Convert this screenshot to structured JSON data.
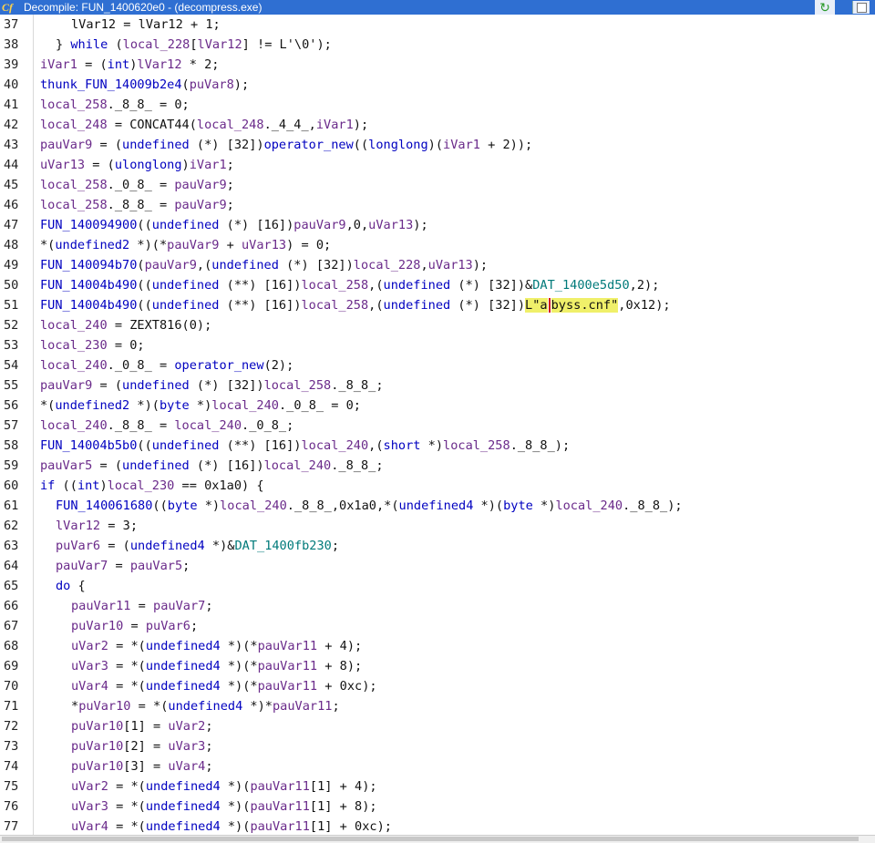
{
  "window": {
    "title": "Decompile: FUN_1400620e0 - (decompress.exe)",
    "app_icon": "Cf",
    "refresh_icon": "refresh-icon",
    "snapshot_icon": "snapshot-icon"
  },
  "lines": [
    {
      "n": "37",
      "indent": 2,
      "tokens": [
        {
          "t": "lVar12 = lVar12 + 1;"
        }
      ]
    },
    {
      "n": "38",
      "indent": 1,
      "tokens": [
        {
          "t": "} "
        },
        {
          "t": "while",
          "c": "kw"
        },
        {
          "t": " ("
        },
        {
          "t": "local_228",
          "c": "var"
        },
        {
          "t": "["
        },
        {
          "t": "lVar12",
          "c": "var"
        },
        {
          "t": "] != L'\\0');"
        }
      ]
    },
    {
      "n": "39",
      "indent": 0,
      "tokens": [
        {
          "t": "iVar1",
          "c": "var"
        },
        {
          "t": " = ("
        },
        {
          "t": "int",
          "c": "ty"
        },
        {
          "t": ")"
        },
        {
          "t": "lVar12",
          "c": "var"
        },
        {
          "t": " * 2;"
        }
      ]
    },
    {
      "n": "40",
      "indent": 0,
      "tokens": [
        {
          "t": "thunk_FUN_14009b2e4",
          "c": "fn"
        },
        {
          "t": "("
        },
        {
          "t": "puVar8",
          "c": "var"
        },
        {
          "t": ");"
        }
      ]
    },
    {
      "n": "41",
      "indent": 0,
      "tokens": [
        {
          "t": "local_258",
          "c": "var"
        },
        {
          "t": "._8_8_ = 0;"
        }
      ]
    },
    {
      "n": "42",
      "indent": 0,
      "tokens": [
        {
          "t": "local_248",
          "c": "var"
        },
        {
          "t": " = CONCAT44("
        },
        {
          "t": "local_248",
          "c": "var"
        },
        {
          "t": "._4_4_,"
        },
        {
          "t": "iVar1",
          "c": "var"
        },
        {
          "t": ");"
        }
      ]
    },
    {
      "n": "43",
      "indent": 0,
      "tokens": [
        {
          "t": "pauVar9",
          "c": "var"
        },
        {
          "t": " = ("
        },
        {
          "t": "undefined",
          "c": "ty"
        },
        {
          "t": " (*) [32])"
        },
        {
          "t": "operator_new",
          "c": "fn"
        },
        {
          "t": "(("
        },
        {
          "t": "longlong",
          "c": "ty"
        },
        {
          "t": ")("
        },
        {
          "t": "iVar1",
          "c": "var"
        },
        {
          "t": " + 2));"
        }
      ]
    },
    {
      "n": "44",
      "indent": 0,
      "tokens": [
        {
          "t": "uVar13",
          "c": "var"
        },
        {
          "t": " = ("
        },
        {
          "t": "ulonglong",
          "c": "ty"
        },
        {
          "t": ")"
        },
        {
          "t": "iVar1",
          "c": "var"
        },
        {
          "t": ";"
        }
      ]
    },
    {
      "n": "45",
      "indent": 0,
      "tokens": [
        {
          "t": "local_258",
          "c": "var"
        },
        {
          "t": "._0_8_ = "
        },
        {
          "t": "pauVar9",
          "c": "var"
        },
        {
          "t": ";"
        }
      ]
    },
    {
      "n": "46",
      "indent": 0,
      "tokens": [
        {
          "t": "local_258",
          "c": "var"
        },
        {
          "t": "._8_8_ = "
        },
        {
          "t": "pauVar9",
          "c": "var"
        },
        {
          "t": ";"
        }
      ]
    },
    {
      "n": "47",
      "indent": 0,
      "tokens": [
        {
          "t": "FUN_140094900",
          "c": "fn"
        },
        {
          "t": "(("
        },
        {
          "t": "undefined",
          "c": "ty"
        },
        {
          "t": " (*) [16])"
        },
        {
          "t": "pauVar9",
          "c": "var"
        },
        {
          "t": ",0,"
        },
        {
          "t": "uVar13",
          "c": "var"
        },
        {
          "t": ");"
        }
      ]
    },
    {
      "n": "48",
      "indent": 0,
      "tokens": [
        {
          "t": "*("
        },
        {
          "t": "undefined2",
          "c": "ty"
        },
        {
          "t": " *)(*"
        },
        {
          "t": "pauVar9",
          "c": "var"
        },
        {
          "t": " + "
        },
        {
          "t": "uVar13",
          "c": "var"
        },
        {
          "t": ") = 0;"
        }
      ]
    },
    {
      "n": "49",
      "indent": 0,
      "tokens": [
        {
          "t": "FUN_140094b70",
          "c": "fn"
        },
        {
          "t": "("
        },
        {
          "t": "pauVar9",
          "c": "var"
        },
        {
          "t": ",("
        },
        {
          "t": "undefined",
          "c": "ty"
        },
        {
          "t": " (*) [32])"
        },
        {
          "t": "local_228",
          "c": "var"
        },
        {
          "t": ","
        },
        {
          "t": "uVar13",
          "c": "var"
        },
        {
          "t": ");"
        }
      ]
    },
    {
      "n": "50",
      "indent": 0,
      "tokens": [
        {
          "t": "FUN_14004b490",
          "c": "fn"
        },
        {
          "t": "(("
        },
        {
          "t": "undefined",
          "c": "ty"
        },
        {
          "t": " (**) [16])"
        },
        {
          "t": "local_258",
          "c": "var"
        },
        {
          "t": ",("
        },
        {
          "t": "undefined",
          "c": "ty"
        },
        {
          "t": " (*) [32])&"
        },
        {
          "t": "DAT_1400e5d50",
          "c": "gl"
        },
        {
          "t": ",2);"
        }
      ]
    },
    {
      "n": "51",
      "indent": 0,
      "tokens": [
        {
          "t": "FUN_14004b490",
          "c": "fn"
        },
        {
          "t": "(("
        },
        {
          "t": "undefined",
          "c": "ty"
        },
        {
          "t": " (**) [16])"
        },
        {
          "t": "local_258",
          "c": "var"
        },
        {
          "t": ",("
        },
        {
          "t": "undefined",
          "c": "ty"
        },
        {
          "t": " (*) [32])"
        },
        {
          "t": "L\"a",
          "c": "hl"
        },
        {
          "caret": true
        },
        {
          "t": "byss.cnf\"",
          "c": "hl"
        },
        {
          "t": ",0x12);"
        }
      ]
    },
    {
      "n": "52",
      "indent": 0,
      "tokens": [
        {
          "t": "local_240",
          "c": "var"
        },
        {
          "t": " = ZEXT816(0);"
        }
      ]
    },
    {
      "n": "53",
      "indent": 0,
      "tokens": [
        {
          "t": "local_230",
          "c": "var"
        },
        {
          "t": " = 0;"
        }
      ]
    },
    {
      "n": "54",
      "indent": 0,
      "tokens": [
        {
          "t": "local_240",
          "c": "var"
        },
        {
          "t": "._0_8_ = "
        },
        {
          "t": "operator_new",
          "c": "fn"
        },
        {
          "t": "(2);"
        }
      ]
    },
    {
      "n": "55",
      "indent": 0,
      "tokens": [
        {
          "t": "pauVar9",
          "c": "var"
        },
        {
          "t": " = ("
        },
        {
          "t": "undefined",
          "c": "ty"
        },
        {
          "t": " (*) [32])"
        },
        {
          "t": "local_258",
          "c": "var"
        },
        {
          "t": "._8_8_;"
        }
      ]
    },
    {
      "n": "56",
      "indent": 0,
      "tokens": [
        {
          "t": "*("
        },
        {
          "t": "undefined2",
          "c": "ty"
        },
        {
          "t": " *)("
        },
        {
          "t": "byte",
          "c": "ty"
        },
        {
          "t": " *)"
        },
        {
          "t": "local_240",
          "c": "var"
        },
        {
          "t": "._0_8_ = 0;"
        }
      ]
    },
    {
      "n": "57",
      "indent": 0,
      "tokens": [
        {
          "t": "local_240",
          "c": "var"
        },
        {
          "t": "._8_8_ = "
        },
        {
          "t": "local_240",
          "c": "var"
        },
        {
          "t": "._0_8_;"
        }
      ]
    },
    {
      "n": "58",
      "indent": 0,
      "tokens": [
        {
          "t": "FUN_14004b5b0",
          "c": "fn"
        },
        {
          "t": "(("
        },
        {
          "t": "undefined",
          "c": "ty"
        },
        {
          "t": " (**) [16])"
        },
        {
          "t": "local_240",
          "c": "var"
        },
        {
          "t": ",("
        },
        {
          "t": "short",
          "c": "ty"
        },
        {
          "t": " *)"
        },
        {
          "t": "local_258",
          "c": "var"
        },
        {
          "t": "._8_8_);"
        }
      ]
    },
    {
      "n": "59",
      "indent": 0,
      "tokens": [
        {
          "t": "pauVar5",
          "c": "var"
        },
        {
          "t": " = ("
        },
        {
          "t": "undefined",
          "c": "ty"
        },
        {
          "t": " (*) [16])"
        },
        {
          "t": "local_240",
          "c": "var"
        },
        {
          "t": "._8_8_;"
        }
      ]
    },
    {
      "n": "60",
      "indent": 0,
      "tokens": [
        {
          "t": "if",
          "c": "kw"
        },
        {
          "t": " (("
        },
        {
          "t": "int",
          "c": "ty"
        },
        {
          "t": ")"
        },
        {
          "t": "local_230",
          "c": "var"
        },
        {
          "t": " == 0x1a0) {"
        }
      ]
    },
    {
      "n": "61",
      "indent": 1,
      "tokens": [
        {
          "t": "FUN_140061680",
          "c": "fn"
        },
        {
          "t": "(("
        },
        {
          "t": "byte",
          "c": "ty"
        },
        {
          "t": " *)"
        },
        {
          "t": "local_240",
          "c": "var"
        },
        {
          "t": "._8_8_,0x1a0,*("
        },
        {
          "t": "undefined4",
          "c": "ty"
        },
        {
          "t": " *)("
        },
        {
          "t": "byte",
          "c": "ty"
        },
        {
          "t": " *)"
        },
        {
          "t": "local_240",
          "c": "var"
        },
        {
          "t": "._8_8_);"
        }
      ]
    },
    {
      "n": "62",
      "indent": 1,
      "tokens": [
        {
          "t": "lVar12",
          "c": "var"
        },
        {
          "t": " = 3;"
        }
      ]
    },
    {
      "n": "63",
      "indent": 1,
      "tokens": [
        {
          "t": "puVar6",
          "c": "var"
        },
        {
          "t": " = ("
        },
        {
          "t": "undefined4",
          "c": "ty"
        },
        {
          "t": " *)&"
        },
        {
          "t": "DAT_1400fb230",
          "c": "gl"
        },
        {
          "t": ";"
        }
      ]
    },
    {
      "n": "64",
      "indent": 1,
      "tokens": [
        {
          "t": "pauVar7",
          "c": "var"
        },
        {
          "t": " = "
        },
        {
          "t": "pauVar5",
          "c": "var"
        },
        {
          "t": ";"
        }
      ]
    },
    {
      "n": "65",
      "indent": 1,
      "tokens": [
        {
          "t": "do",
          "c": "kw"
        },
        {
          "t": " {"
        }
      ]
    },
    {
      "n": "66",
      "indent": 2,
      "tokens": [
        {
          "t": "pauVar11",
          "c": "var"
        },
        {
          "t": " = "
        },
        {
          "t": "pauVar7",
          "c": "var"
        },
        {
          "t": ";"
        }
      ]
    },
    {
      "n": "67",
      "indent": 2,
      "tokens": [
        {
          "t": "puVar10",
          "c": "var"
        },
        {
          "t": " = "
        },
        {
          "t": "puVar6",
          "c": "var"
        },
        {
          "t": ";"
        }
      ]
    },
    {
      "n": "68",
      "indent": 2,
      "tokens": [
        {
          "t": "uVar2",
          "c": "var"
        },
        {
          "t": " = *("
        },
        {
          "t": "undefined4",
          "c": "ty"
        },
        {
          "t": " *)(*"
        },
        {
          "t": "pauVar11",
          "c": "var"
        },
        {
          "t": " + 4);"
        }
      ]
    },
    {
      "n": "69",
      "indent": 2,
      "tokens": [
        {
          "t": "uVar3",
          "c": "var"
        },
        {
          "t": " = *("
        },
        {
          "t": "undefined4",
          "c": "ty"
        },
        {
          "t": " *)(*"
        },
        {
          "t": "pauVar11",
          "c": "var"
        },
        {
          "t": " + 8);"
        }
      ]
    },
    {
      "n": "70",
      "indent": 2,
      "tokens": [
        {
          "t": "uVar4",
          "c": "var"
        },
        {
          "t": " = *("
        },
        {
          "t": "undefined4",
          "c": "ty"
        },
        {
          "t": " *)(*"
        },
        {
          "t": "pauVar11",
          "c": "var"
        },
        {
          "t": " + 0xc);"
        }
      ]
    },
    {
      "n": "71",
      "indent": 2,
      "tokens": [
        {
          "t": "*"
        },
        {
          "t": "puVar10",
          "c": "var"
        },
        {
          "t": " = *("
        },
        {
          "t": "undefined4",
          "c": "ty"
        },
        {
          "t": " *)*"
        },
        {
          "t": "pauVar11",
          "c": "var"
        },
        {
          "t": ";"
        }
      ]
    },
    {
      "n": "72",
      "indent": 2,
      "tokens": [
        {
          "t": "puVar10",
          "c": "var"
        },
        {
          "t": "[1] = "
        },
        {
          "t": "uVar2",
          "c": "var"
        },
        {
          "t": ";"
        }
      ]
    },
    {
      "n": "73",
      "indent": 2,
      "tokens": [
        {
          "t": "puVar10",
          "c": "var"
        },
        {
          "t": "[2] = "
        },
        {
          "t": "uVar3",
          "c": "var"
        },
        {
          "t": ";"
        }
      ]
    },
    {
      "n": "74",
      "indent": 2,
      "tokens": [
        {
          "t": "puVar10",
          "c": "var"
        },
        {
          "t": "[3] = "
        },
        {
          "t": "uVar4",
          "c": "var"
        },
        {
          "t": ";"
        }
      ]
    },
    {
      "n": "75",
      "indent": 2,
      "tokens": [
        {
          "t": "uVar2",
          "c": "var"
        },
        {
          "t": " = *("
        },
        {
          "t": "undefined4",
          "c": "ty"
        },
        {
          "t": " *)("
        },
        {
          "t": "pauVar11",
          "c": "var"
        },
        {
          "t": "[1] + 4);"
        }
      ]
    },
    {
      "n": "76",
      "indent": 2,
      "tokens": [
        {
          "t": "uVar3",
          "c": "var"
        },
        {
          "t": " = *("
        },
        {
          "t": "undefined4",
          "c": "ty"
        },
        {
          "t": " *)("
        },
        {
          "t": "pauVar11",
          "c": "var"
        },
        {
          "t": "[1] + 8);"
        }
      ]
    },
    {
      "n": "77",
      "indent": 2,
      "tokens": [
        {
          "t": "uVar4",
          "c": "var"
        },
        {
          "t": " = *("
        },
        {
          "t": "undefined4",
          "c": "ty"
        },
        {
          "t": " *)("
        },
        {
          "t": "pauVar11",
          "c": "var"
        },
        {
          "t": "[1] + 0xc);"
        }
      ]
    }
  ]
}
